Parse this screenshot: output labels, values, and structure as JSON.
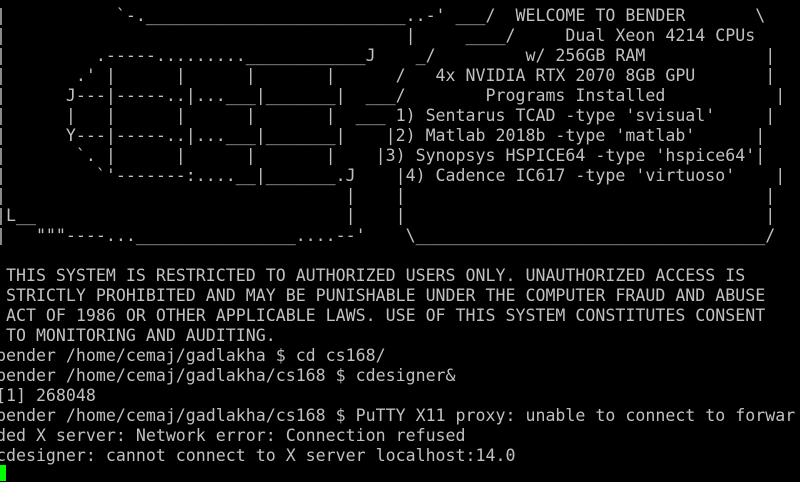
{
  "terminal": {
    "text_color": "#c0c0c0",
    "background": "#000000",
    "cursor_color": "#00ff00",
    "lines": [
      "  |           `-.__________________________..-' ___/  WELCOME TO BENDER       \\",
      "  |                                        |     ____/     Dual Xeon 4214 CPUs     |",
      "  |         .-----.........____________J    _/         w/ 256GB RAM            |",
      "  |       .' |      |      |       |      /   4x NVIDIA RTX 2070 8GB GPU       |",
      "  |      J---|-----..|...___|_______|  ___/        Programs Installed           |",
      "  |      |   |      |      |       |  ___ 1) Sentarus TCAD -type 'svisual'     |",
      "  |      Y---|-----..|...___|_______|    |2) Matlab 2018b -type 'matlab'      |",
      "  |       `. |      |      |       |    |3) Synopsys HSPICE64 -type 'hspice64'|",
      "  |         `'-------:....__|_______.J    |4) Cadence IC617 -type 'virtuoso'    |",
      "  |                                  |    |                                    |",
      "  |L__                               |    |                                    |",
      "  |   \"\"\"----...________________....--'    \\___________________________________/",
      "",
      "   THIS SYSTEM IS RESTRICTED TO AUTHORIZED USERS ONLY. UNAUTHORIZED ACCESS IS",
      "   STRICTLY PROHIBITED AND MAY BE PUNISHABLE UNDER THE COMPUTER FRAUD AND ABUSE",
      "   ACT OF 1986 OR OTHER APPLICABLE LAWS. USE OF THIS SYSTEM CONSTITUTES CONSENT",
      "   TO MONITORING AND AUDITING.",
      "  bender /home/cemaj/gadlakha $ cd cs168/",
      "  bender /home/cemaj/gadlakha/cs168 $ cdesigner&",
      "  [1] 268048",
      "  bender /home/cemaj/gadlakha/cs168 $ PuTTY X11 proxy: unable to connect to forwar",
      "  ded X server: Network error: Connection refused",
      "  cdesigner: cannot connect to X server localhost:14.0"
    ]
  }
}
